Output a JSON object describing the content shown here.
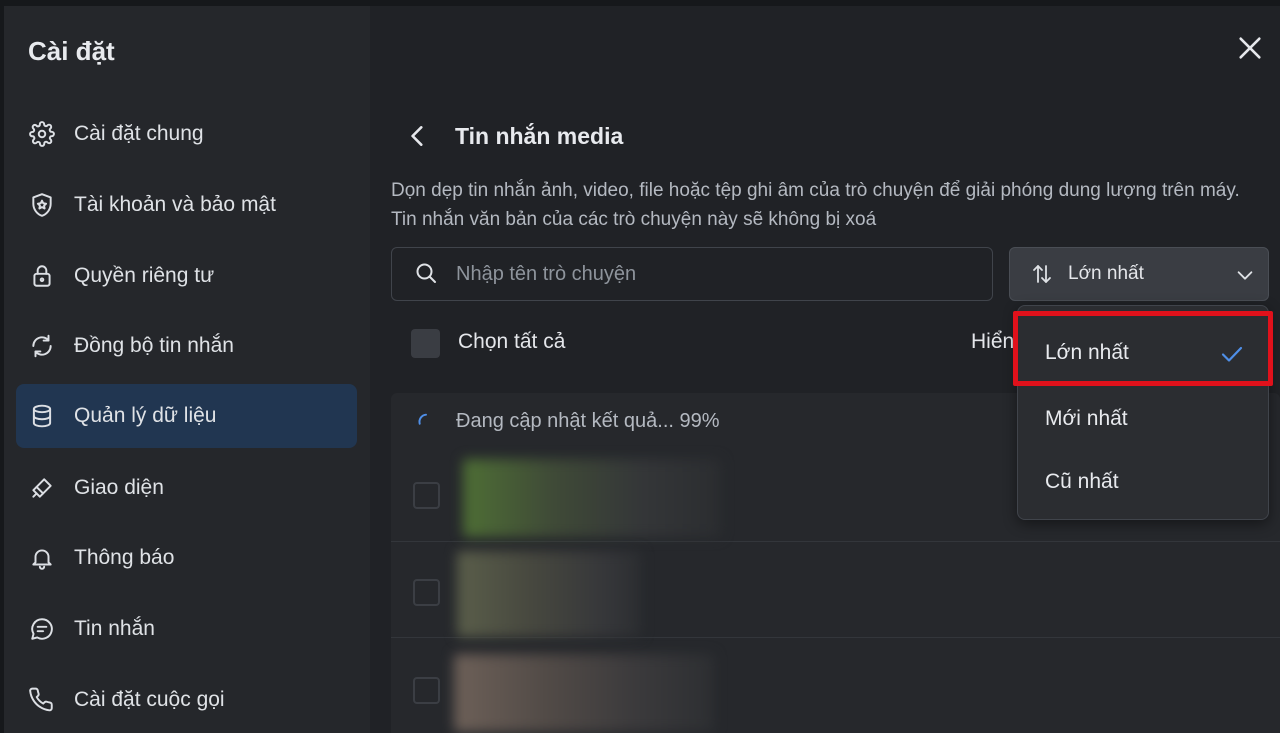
{
  "sidebar": {
    "title": "Cài đặt",
    "items": [
      {
        "label": "Cài đặt chung",
        "icon": "gear-icon"
      },
      {
        "label": "Tài khoản và bảo mật",
        "icon": "shield-icon"
      },
      {
        "label": "Quyền riêng tư",
        "icon": "lock-icon"
      },
      {
        "label": "Đồng bộ tin nhắn",
        "icon": "sync-icon"
      },
      {
        "label": "Quản lý dữ liệu",
        "icon": "database-icon",
        "active": true
      },
      {
        "label": "Giao diện",
        "icon": "brush-icon"
      },
      {
        "label": "Thông báo",
        "icon": "bell-icon"
      },
      {
        "label": "Tin nhắn",
        "icon": "message-icon"
      },
      {
        "label": "Cài đặt cuộc gọi",
        "icon": "phone-icon"
      }
    ]
  },
  "header": {
    "title": "Tin nhắn media"
  },
  "description": "Dọn dẹp tin nhắn ảnh, video, file hoặc tệp ghi âm của trò chuyện để giải phóng dung lượng trên máy. Tin nhắn văn bản của các trò chuyện này sẽ không bị xoá",
  "search": {
    "placeholder": "Nhập tên trò chuyện",
    "value": ""
  },
  "sort": {
    "selected": "Lớn nhất",
    "options": [
      {
        "label": "Lớn nhất",
        "checked": true
      },
      {
        "label": "Mới nhất",
        "checked": false
      },
      {
        "label": "Cũ nhất",
        "checked": false
      }
    ]
  },
  "list": {
    "select_all_label": "Chọn tất cả",
    "display_label_partial": "Hiển",
    "loading_text": "Đang cập nhật kết quả... 99%",
    "loading_progress": 0.99
  },
  "colors": {
    "accent": "#4f8fe8",
    "active_nav_bg": "#213651",
    "highlight": "#e0111b"
  }
}
